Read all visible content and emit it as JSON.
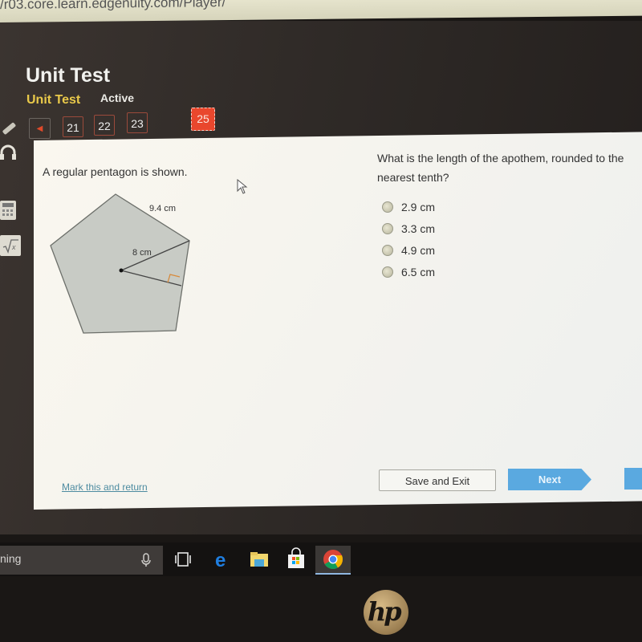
{
  "browser": {
    "url": "/r03.core.learn.edgenuity.com/Player/"
  },
  "header": {
    "title": "Unit Test",
    "subtitle": "Unit Test",
    "status": "Active"
  },
  "question_nav": {
    "prev_label": "◀",
    "items": [
      "21",
      "22",
      "23"
    ],
    "current": "25"
  },
  "tools": [
    "pencil-icon",
    "headphones-icon",
    "calculator-icon",
    "square-root-icon"
  ],
  "problem": {
    "prompt": "A regular pentagon is shown.",
    "side_label": "9.4 cm",
    "radius_label": "8 cm",
    "question": "What is the length of the apothem, rounded to the nearest tenth?",
    "choices": [
      "2.9 cm",
      "3.3 cm",
      "4.9 cm",
      "6.5 cm"
    ]
  },
  "footer": {
    "mark_link": "Mark this and return",
    "save_button": "Save and Exit",
    "next_button": "Next"
  },
  "taskbar": {
    "search_text": "ning",
    "icons": [
      "microphone-icon",
      "task-view-icon",
      "edge-icon",
      "file-explorer-icon",
      "store-icon",
      "chrome-icon"
    ]
  },
  "device": {
    "brand": "hp"
  }
}
